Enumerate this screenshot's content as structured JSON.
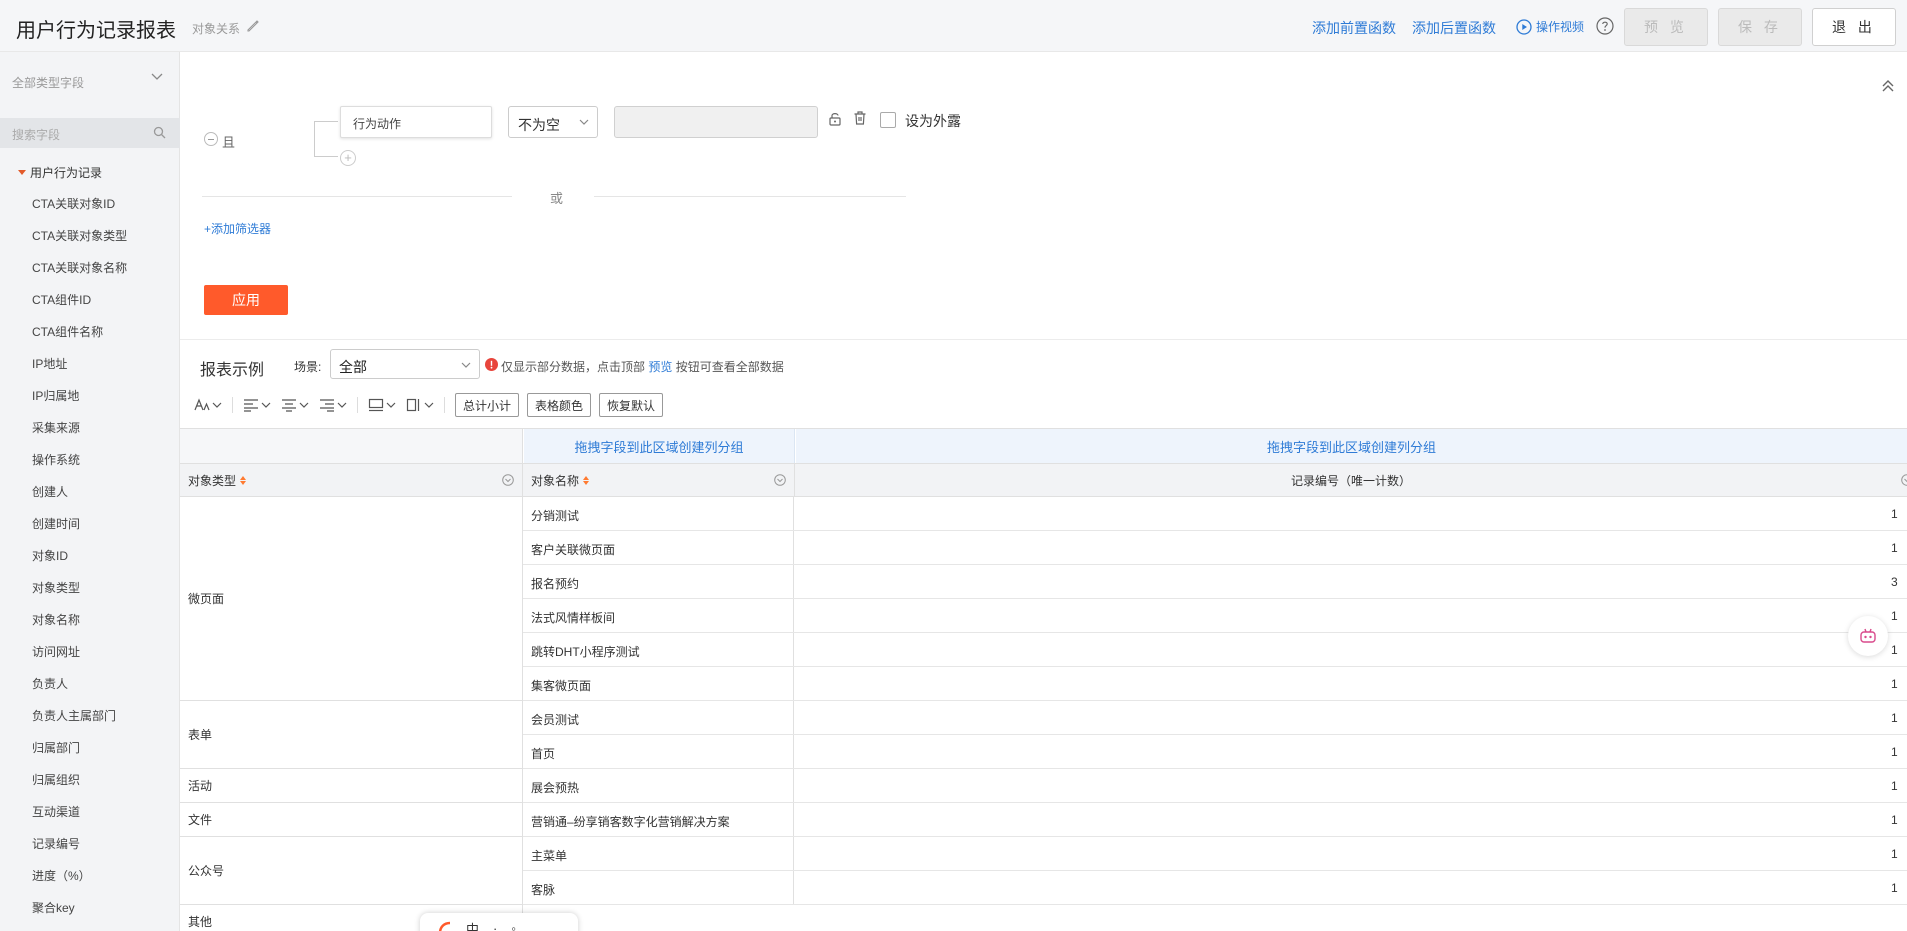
{
  "header": {
    "title": "用户行为记录报表",
    "subtitle": "对象关系",
    "links": {
      "pre_function": "添加前置函数",
      "post_function": "添加后置函数",
      "video": "操作视频"
    },
    "buttons": {
      "preview": "预 览",
      "save": "保 存",
      "exit": "退 出"
    }
  },
  "sidebar": {
    "type_select": "全部类型字段",
    "search_placeholder": "搜索字段",
    "group": "用户行为记录",
    "fields": [
      "CTA关联对象ID",
      "CTA关联对象类型",
      "CTA关联对象名称",
      "CTA组件ID",
      "CTA组件名称",
      "IP地址",
      "IP归属地",
      "采集来源",
      "操作系统",
      "创建人",
      "创建时间",
      "对象ID",
      "对象类型",
      "对象名称",
      "访问网址",
      "负责人",
      "负责人主属部门",
      "归属部门",
      "归属组织",
      "互动渠道",
      "记录编号",
      "进度（%）",
      "聚合key"
    ]
  },
  "filter": {
    "and_label": "且",
    "field": "行为动作",
    "operator": "不为空",
    "expose_label": "设为外露",
    "or_label": "或",
    "add_filter": "+添加筛选器",
    "apply": "应用"
  },
  "report": {
    "title": "报表示例",
    "scene_label": "场景:",
    "scene_value": "全部",
    "notice_prefix": "仅显示部分数据，点击顶部",
    "notice_link": "预览",
    "notice_suffix": "按钮可查看全部数据",
    "toolbar_buttons": {
      "subtotal": "总计小计",
      "table_color": "表格颜色",
      "reset": "恢复默认"
    }
  },
  "table": {
    "drop_hint_1": "拖拽字段到此区域创建列分组",
    "drop_hint_2": "拖拽字段到此区域创建列分组",
    "col_type": "对象类型",
    "col_name": "对象名称",
    "col_count": "记录编号（唯一计数）",
    "groups": [
      {
        "type": "微页面",
        "rows": [
          {
            "name": "分销测试",
            "value": "1"
          },
          {
            "name": "客户关联微页面",
            "value": "1"
          },
          {
            "name": "报名预约",
            "value": "3"
          },
          {
            "name": "法式风情样板间",
            "value": "1"
          },
          {
            "name": "跳转DHT小程序测试",
            "value": "1"
          },
          {
            "name": "集客微页面",
            "value": "1"
          }
        ]
      },
      {
        "type": "表单",
        "rows": [
          {
            "name": "会员测试",
            "value": "1"
          },
          {
            "name": "首页",
            "value": "1"
          }
        ]
      },
      {
        "type": "活动",
        "rows": [
          {
            "name": "展会预热",
            "value": "1"
          }
        ]
      },
      {
        "type": "文件",
        "rows": [
          {
            "name": "营销通–纷享销客数字化营销解决方案",
            "value": "1"
          }
        ]
      },
      {
        "type": "公众号",
        "rows": [
          {
            "name": "主菜单",
            "value": "1"
          },
          {
            "name": "客脉",
            "value": "1"
          }
        ]
      },
      {
        "type": "其他",
        "rows": []
      }
    ]
  },
  "colors": {
    "accent": "#2e7bd6",
    "apply": "#ff5a2b",
    "sort": "#ff7a30"
  }
}
